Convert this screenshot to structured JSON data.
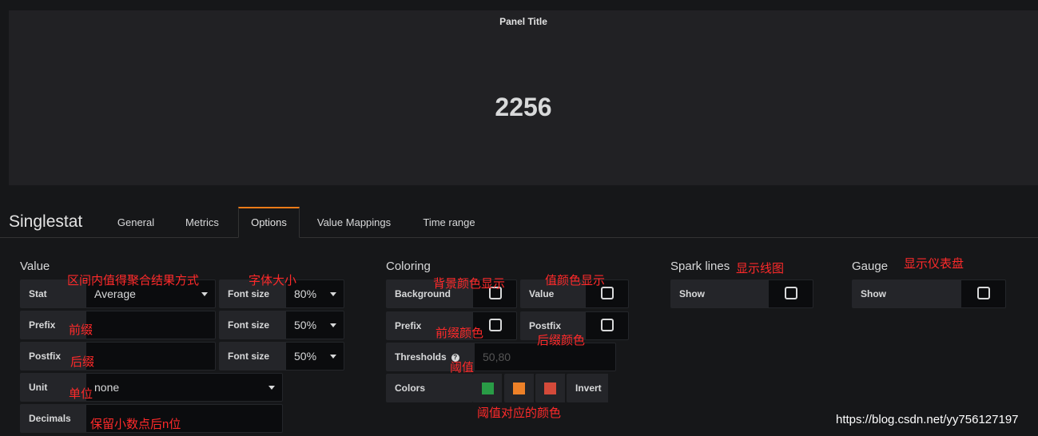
{
  "panel": {
    "title": "Panel Title",
    "value": "2256"
  },
  "editor": {
    "title": "Singlestat",
    "tabs": [
      "General",
      "Metrics",
      "Options",
      "Value Mappings",
      "Time range"
    ],
    "active_tab": "Options"
  },
  "value_section": {
    "title": "Value",
    "stat_label": "Stat",
    "stat_value": "Average",
    "prefix_label": "Prefix",
    "prefix_value": "",
    "postfix_label": "Postfix",
    "postfix_value": "",
    "unit_label": "Unit",
    "unit_value": "none",
    "decimals_label": "Decimals",
    "decimals_value": "",
    "font_size_label": "Font size",
    "stat_font_size": "80%",
    "prefix_font_size": "50%",
    "postfix_font_size": "50%"
  },
  "coloring": {
    "title": "Coloring",
    "background_label": "Background",
    "value_label": "Value",
    "prefix_label": "Prefix",
    "postfix_label": "Postfix",
    "thresholds_label": "Thresholds",
    "thresholds_placeholder": "50,80",
    "colors_label": "Colors",
    "invert_label": "Invert",
    "colors": [
      "#299c46",
      "#ed8128",
      "#d44a3a"
    ]
  },
  "spark": {
    "title": "Spark lines",
    "show_label": "Show"
  },
  "gauge": {
    "title": "Gauge",
    "show_label": "Show"
  },
  "annotations": {
    "stat": "区间内值得聚合结果方式",
    "font_size": "字体大小",
    "prefix": "前缀",
    "postfix": "后缀",
    "unit": "单位",
    "decimals": "保留小数点后n位",
    "background": "背景颜色显示",
    "value_color": "值颜色显示",
    "prefix_color": "前缀颜色",
    "postfix_color": "后缀颜色",
    "thresholds": "阈值",
    "threshold_colors": "阈值对应的颜色",
    "sparklines": "显示线图",
    "gauge": "显示仪表盘"
  },
  "watermark": "https://blog.csdn.net/yy756127197"
}
